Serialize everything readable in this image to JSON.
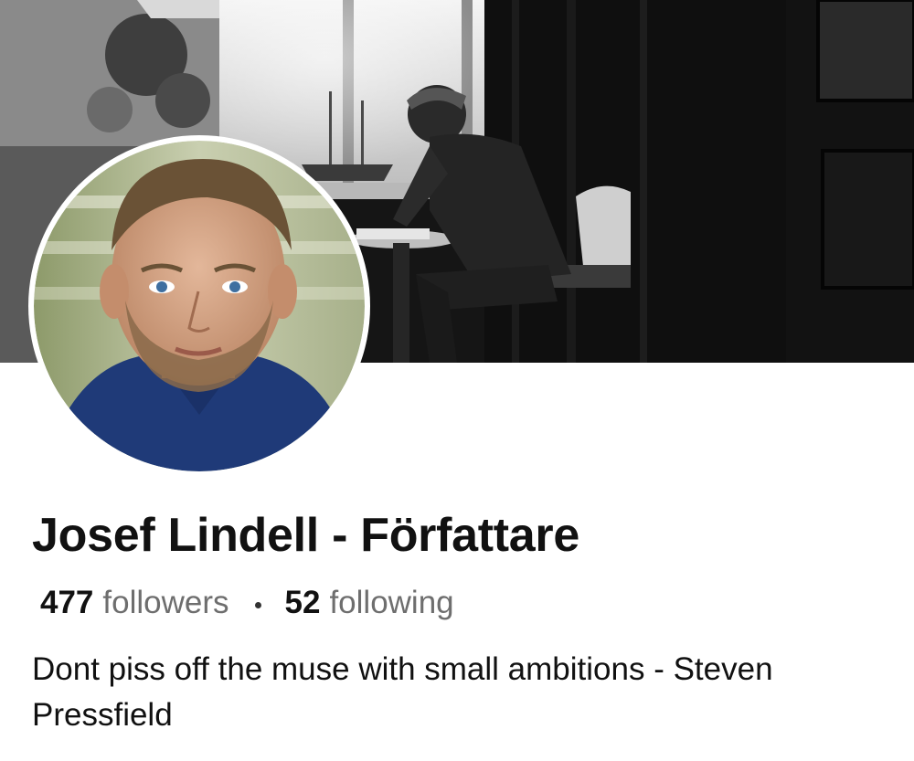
{
  "profile": {
    "name": "Josef Lindell - Författare",
    "followers_count": "477",
    "followers_label": "followers",
    "following_count": "52",
    "following_label": "following",
    "bio": "Dont piss off the muse with small ambitions - Steven Pressfield"
  },
  "images": {
    "cover": "cover-photo-writer-at-desk",
    "avatar": "profile-portrait"
  },
  "colors": {
    "text_primary": "#111111",
    "text_secondary": "#6e6e6e",
    "background": "#ffffff"
  }
}
